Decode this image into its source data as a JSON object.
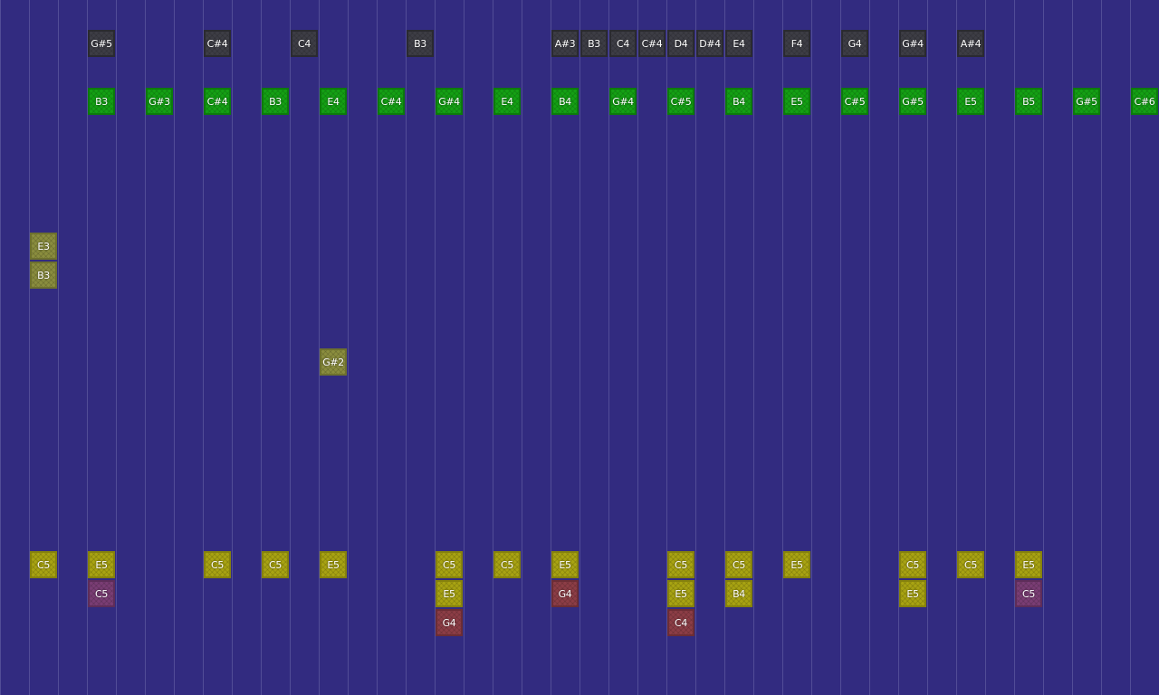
{
  "colors": {
    "background": "#322b80",
    "gridline": "#7f7abf",
    "gray_note": "#3d3d45",
    "green_note": "#14a014",
    "olive_note": "#8a8d3e",
    "yellow_note": "#a8a312",
    "purple_note": "#7a3d74",
    "red_note": "#8c3d46"
  },
  "notes": [
    {
      "label": "G#5",
      "type": "gray"
    },
    {
      "label": "C#4",
      "type": "gray"
    },
    {
      "label": "C4",
      "type": "gray"
    },
    {
      "label": "B3",
      "type": "gray"
    },
    {
      "label": "A#3",
      "type": "gray"
    },
    {
      "label": "B3",
      "type": "gray"
    },
    {
      "label": "C4",
      "type": "gray"
    },
    {
      "label": "C#4",
      "type": "gray"
    },
    {
      "label": "D4",
      "type": "gray"
    },
    {
      "label": "D#4",
      "type": "gray"
    },
    {
      "label": "E4",
      "type": "gray"
    },
    {
      "label": "F4",
      "type": "gray"
    },
    {
      "label": "G4",
      "type": "gray"
    },
    {
      "label": "G#4",
      "type": "gray"
    },
    {
      "label": "A#4",
      "type": "gray"
    },
    {
      "label": "B3",
      "type": "green"
    },
    {
      "label": "G#3",
      "type": "green"
    },
    {
      "label": "C#4",
      "type": "green"
    },
    {
      "label": "B3",
      "type": "green"
    },
    {
      "label": "E4",
      "type": "green"
    },
    {
      "label": "C#4",
      "type": "green"
    },
    {
      "label": "G#4",
      "type": "green"
    },
    {
      "label": "E4",
      "type": "green"
    },
    {
      "label": "B4",
      "type": "green"
    },
    {
      "label": "G#4",
      "type": "green"
    },
    {
      "label": "C#5",
      "type": "green"
    },
    {
      "label": "B4",
      "type": "green"
    },
    {
      "label": "E5",
      "type": "green"
    },
    {
      "label": "C#5",
      "type": "green"
    },
    {
      "label": "G#5",
      "type": "green"
    },
    {
      "label": "E5",
      "type": "green"
    },
    {
      "label": "B5",
      "type": "green"
    },
    {
      "label": "G#5",
      "type": "green"
    },
    {
      "label": "C#6",
      "type": "green"
    },
    {
      "label": "E3",
      "type": "olive"
    },
    {
      "label": "B3",
      "type": "olive"
    },
    {
      "label": "G#2",
      "type": "olive"
    },
    {
      "label": "C5",
      "type": "yellow"
    },
    {
      "label": "E5",
      "type": "yellow"
    },
    {
      "label": "C5",
      "type": "yellow"
    },
    {
      "label": "C5",
      "type": "yellow"
    },
    {
      "label": "E5",
      "type": "yellow"
    },
    {
      "label": "C5",
      "type": "yellow"
    },
    {
      "label": "C5",
      "type": "yellow"
    },
    {
      "label": "E5",
      "type": "yellow"
    },
    {
      "label": "C5",
      "type": "yellow"
    },
    {
      "label": "C5",
      "type": "yellow"
    },
    {
      "label": "E5",
      "type": "yellow"
    },
    {
      "label": "C5",
      "type": "yellow"
    },
    {
      "label": "C5",
      "type": "yellow"
    },
    {
      "label": "E5",
      "type": "yellow"
    },
    {
      "label": "C5",
      "type": "purple"
    },
    {
      "label": "E5",
      "type": "yellow"
    },
    {
      "label": "G4",
      "type": "red"
    },
    {
      "label": "E5",
      "type": "yellow"
    },
    {
      "label": "B4",
      "type": "yellow"
    },
    {
      "label": "E5",
      "type": "yellow"
    },
    {
      "label": "C5",
      "type": "purple"
    },
    {
      "label": "G4",
      "type": "red"
    },
    {
      "label": "C4",
      "type": "red"
    }
  ]
}
